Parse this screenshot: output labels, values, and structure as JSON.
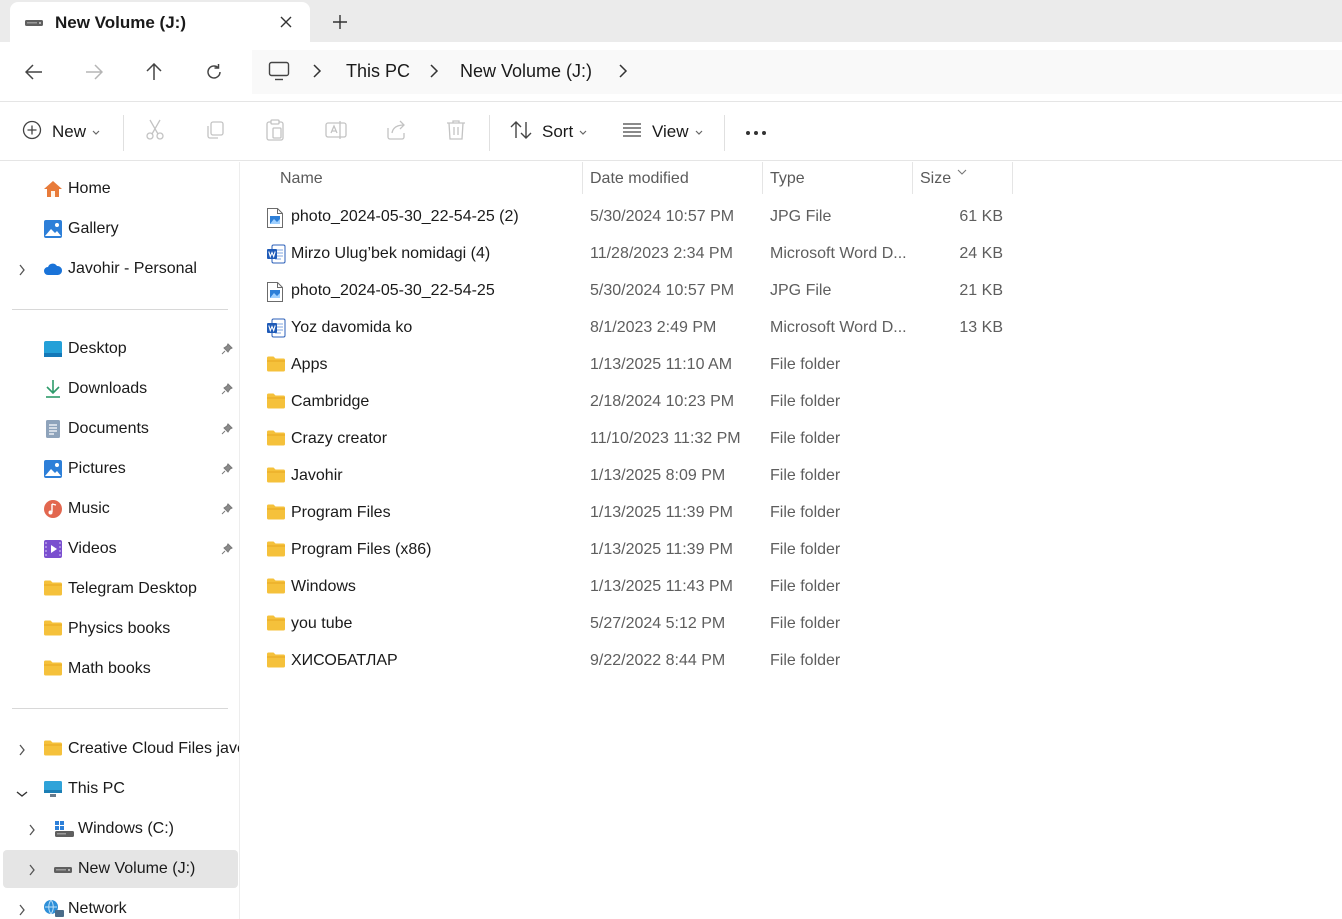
{
  "window": {
    "tab_title": "New Volume (J:)"
  },
  "address": {
    "crumbs": [
      "This PC",
      "New Volume (J:)"
    ]
  },
  "commands": {
    "new": "New",
    "sort": "Sort",
    "view": "View"
  },
  "sidebar": {
    "top": [
      {
        "label": "Home",
        "icon": "home-icon"
      },
      {
        "label": "Gallery",
        "icon": "gallery-icon"
      },
      {
        "label": "Javohir - Personal",
        "icon": "onedrive-icon"
      }
    ],
    "pinned": [
      {
        "label": "Desktop",
        "icon": "desktop-icon"
      },
      {
        "label": "Downloads",
        "icon": "downloads-icon"
      },
      {
        "label": "Documents",
        "icon": "documents-icon"
      },
      {
        "label": "Pictures",
        "icon": "pictures-icon"
      },
      {
        "label": "Music",
        "icon": "music-icon"
      },
      {
        "label": "Videos",
        "icon": "videos-icon"
      },
      {
        "label": "Telegram Desktop",
        "icon": "folder-icon"
      },
      {
        "label": "Physics books",
        "icon": "folder-icon"
      },
      {
        "label": "Math books",
        "icon": "folder-icon"
      }
    ],
    "tree": [
      {
        "label": "Creative Cloud Files  javo",
        "icon": "folder-icon"
      },
      {
        "label": "This PC",
        "icon": "this-pc-icon"
      },
      {
        "label": "Windows (C:)",
        "icon": "windows-drive-icon"
      },
      {
        "label": "New Volume (J:)",
        "icon": "drive-icon"
      },
      {
        "label": "Network",
        "icon": "network-icon"
      }
    ]
  },
  "columns": {
    "name": "Name",
    "date": "Date modified",
    "type": "Type",
    "size": "Size"
  },
  "files": [
    {
      "name": "photo_2024-05-30_22-54-25 (2)",
      "date": "5/30/2024 10:57 PM",
      "type": "JPG File",
      "size": "61 KB",
      "icon": "image-file-icon"
    },
    {
      "name": "Mirzo Ulug’bek nomidagi (4)",
      "date": "11/28/2023 2:34 PM",
      "type": "Microsoft Word D...",
      "size": "24 KB",
      "icon": "word-file-icon"
    },
    {
      "name": "photo_2024-05-30_22-54-25",
      "date": "5/30/2024 10:57 PM",
      "type": "JPG File",
      "size": "21 KB",
      "icon": "image-file-icon"
    },
    {
      "name": "Yoz davomida ko",
      "date": "8/1/2023 2:49 PM",
      "type": "Microsoft Word D...",
      "size": "13 KB",
      "icon": "word-file-icon"
    },
    {
      "name": "Apps",
      "date": "1/13/2025 11:10 AM",
      "type": "File folder",
      "size": "",
      "icon": "folder-icon"
    },
    {
      "name": "Cambridge",
      "date": "2/18/2024 10:23 PM",
      "type": "File folder",
      "size": "",
      "icon": "folder-icon"
    },
    {
      "name": "Crazy creator",
      "date": "11/10/2023 11:32 PM",
      "type": "File folder",
      "size": "",
      "icon": "folder-icon"
    },
    {
      "name": "Javohir",
      "date": "1/13/2025 8:09 PM",
      "type": "File folder",
      "size": "",
      "icon": "folder-icon"
    },
    {
      "name": "Program Files",
      "date": "1/13/2025 11:39 PM",
      "type": "File folder",
      "size": "",
      "icon": "folder-icon"
    },
    {
      "name": "Program Files (x86)",
      "date": "1/13/2025 11:39 PM",
      "type": "File folder",
      "size": "",
      "icon": "folder-icon"
    },
    {
      "name": "Windows",
      "date": "1/13/2025 11:43 PM",
      "type": "File folder",
      "size": "",
      "icon": "folder-icon"
    },
    {
      "name": "you tube",
      "date": "5/27/2024 5:12 PM",
      "type": "File folder",
      "size": "",
      "icon": "folder-icon"
    },
    {
      "name": "ХИСОБАТЛАР",
      "date": "9/22/2022 8:44 PM",
      "type": "File folder",
      "size": "",
      "icon": "folder-icon"
    }
  ],
  "colors": {
    "folder": "#f5c13b",
    "accent": "#0067c0",
    "selected": "#e5e5e5"
  }
}
